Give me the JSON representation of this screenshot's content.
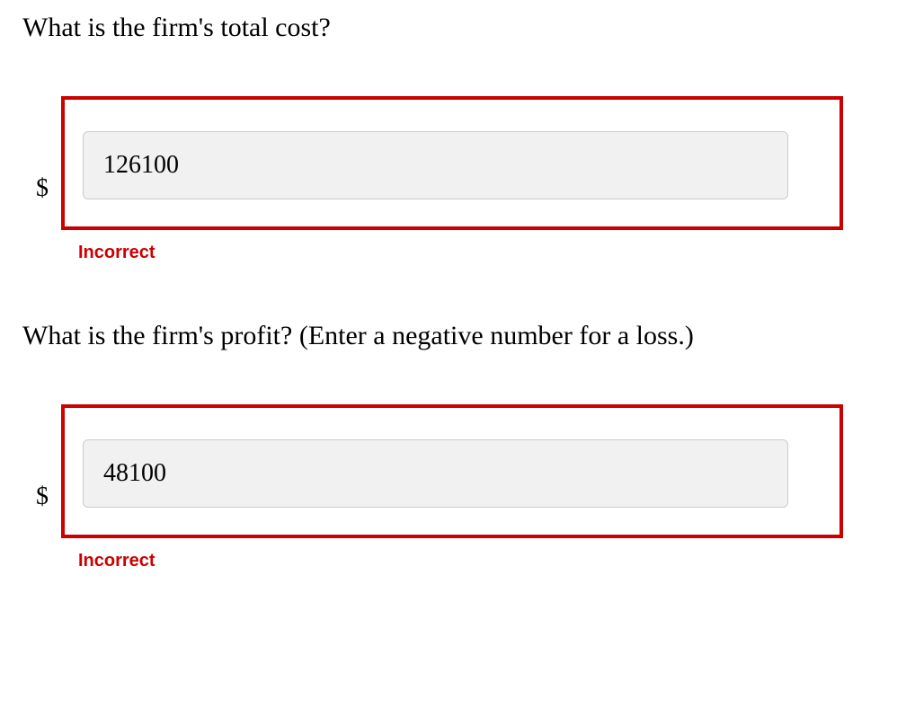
{
  "questions": [
    {
      "prompt": "What is the firm's total cost?",
      "currency": "$",
      "value": "126100",
      "feedback": "Incorrect"
    },
    {
      "prompt": "What is the firm's profit? (Enter a negative number for a loss.)",
      "currency": "$",
      "value": "48100",
      "feedback": "Incorrect"
    }
  ]
}
